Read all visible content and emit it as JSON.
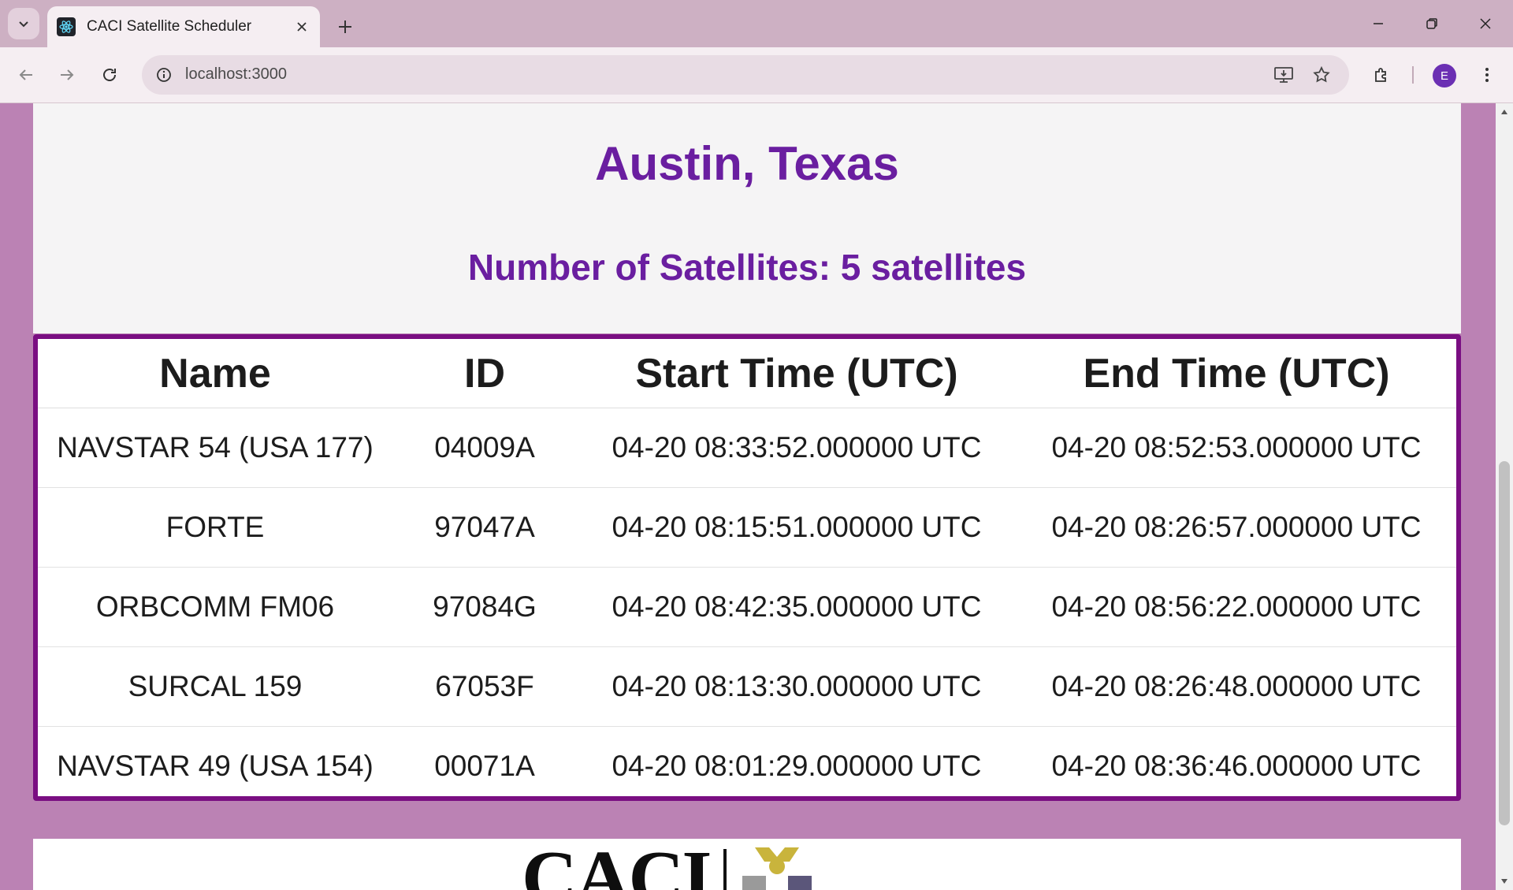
{
  "browser": {
    "tab_title": "CACI Satellite Scheduler",
    "url": "localhost:3000",
    "profile_initial": "E"
  },
  "page": {
    "city": "Austin, Texas",
    "satellite_count": "Number of Satellites: 5 satellites",
    "table": {
      "headers": [
        "Name",
        "ID",
        "Start Time (UTC)",
        "End Time (UTC)"
      ],
      "rows": [
        [
          "NAVSTAR 54 (USA 177)",
          "04009A",
          "04-20 08:33:52.000000 UTC",
          "04-20 08:52:53.000000 UTC"
        ],
        [
          "FORTE",
          "97047A",
          "04-20 08:15:51.000000 UTC",
          "04-20 08:26:57.000000 UTC"
        ],
        [
          "ORBCOMM FM06",
          "97084G",
          "04-20 08:42:35.000000 UTC",
          "04-20 08:56:22.000000 UTC"
        ],
        [
          "SURCAL 159",
          "67053F",
          "04-20 08:13:30.000000 UTC",
          "04-20 08:26:48.000000 UTC"
        ],
        [
          "NAVSTAR 49 (USA 154)",
          "00071A",
          "04-20 08:01:29.000000 UTC",
          "04-20 08:36:46.000000 UTC"
        ]
      ]
    },
    "footer_logo_text": "CACI"
  },
  "colors": {
    "page_background": "#bb82b4",
    "title_purple": "#6a1ea0",
    "table_border": "#7a0e82"
  }
}
